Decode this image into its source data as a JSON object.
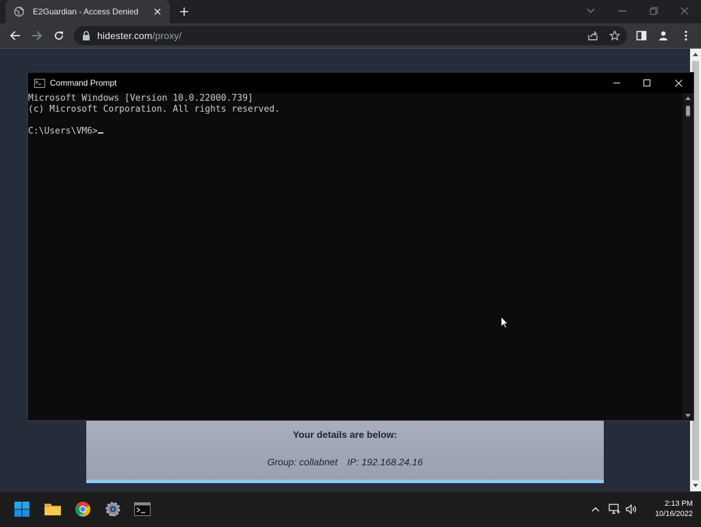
{
  "browser": {
    "tab_title": "E2Guardian - Access Denied",
    "url_host": "hidester.com",
    "url_path": "/proxy/"
  },
  "page": {
    "details_heading": "Your details are below:",
    "group": "Group: collabnet",
    "ip": "IP: 192.168.24.16"
  },
  "cmd": {
    "title": "Command Prompt",
    "lines": [
      "Microsoft Windows [Version 10.0.22000.739]",
      "(c) Microsoft Corporation. All rights reserved.",
      "",
      "C:\\Users\\VM6>"
    ]
  },
  "taskbar": {
    "time": "2:13 PM",
    "date": "10/16/2022"
  },
  "colors": {
    "page_bg": "#262d3a",
    "console_bg": "#0c0c0c",
    "console_text": "#cccccc",
    "accent": "#8ecbf0"
  }
}
